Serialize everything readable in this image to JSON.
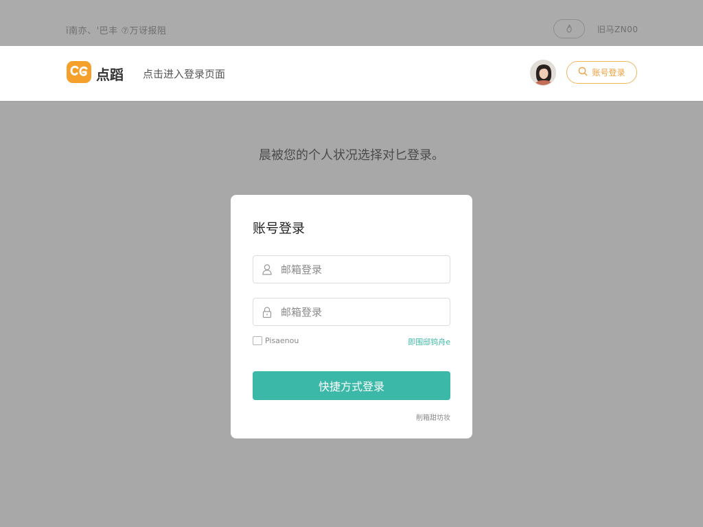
{
  "top_bar": {
    "left_text": "ĭ南亦、'巴丰 ⑦万讶报阻",
    "right_text": "旧马ZN00"
  },
  "header": {
    "brand_name": "点蹈",
    "nav_link": "点击进入登录页面",
    "login_button": "账号登录"
  },
  "prompt": "晨被您的个人状况选择对匕登录。",
  "card": {
    "title": "账号登录",
    "username_placeholder": "邮箱登录",
    "password_placeholder": "邮箱登录",
    "remember_label": "Pisaenou",
    "forgot_link": "即围邸钨舟e",
    "submit_label": "快捷方式登录",
    "alt_link": "削箱甜坊妆"
  },
  "colors": {
    "accent": "#3cb8a8",
    "brand": "#f5a02a",
    "login_pill": "#f0a040",
    "background": "#a8a8a8"
  }
}
